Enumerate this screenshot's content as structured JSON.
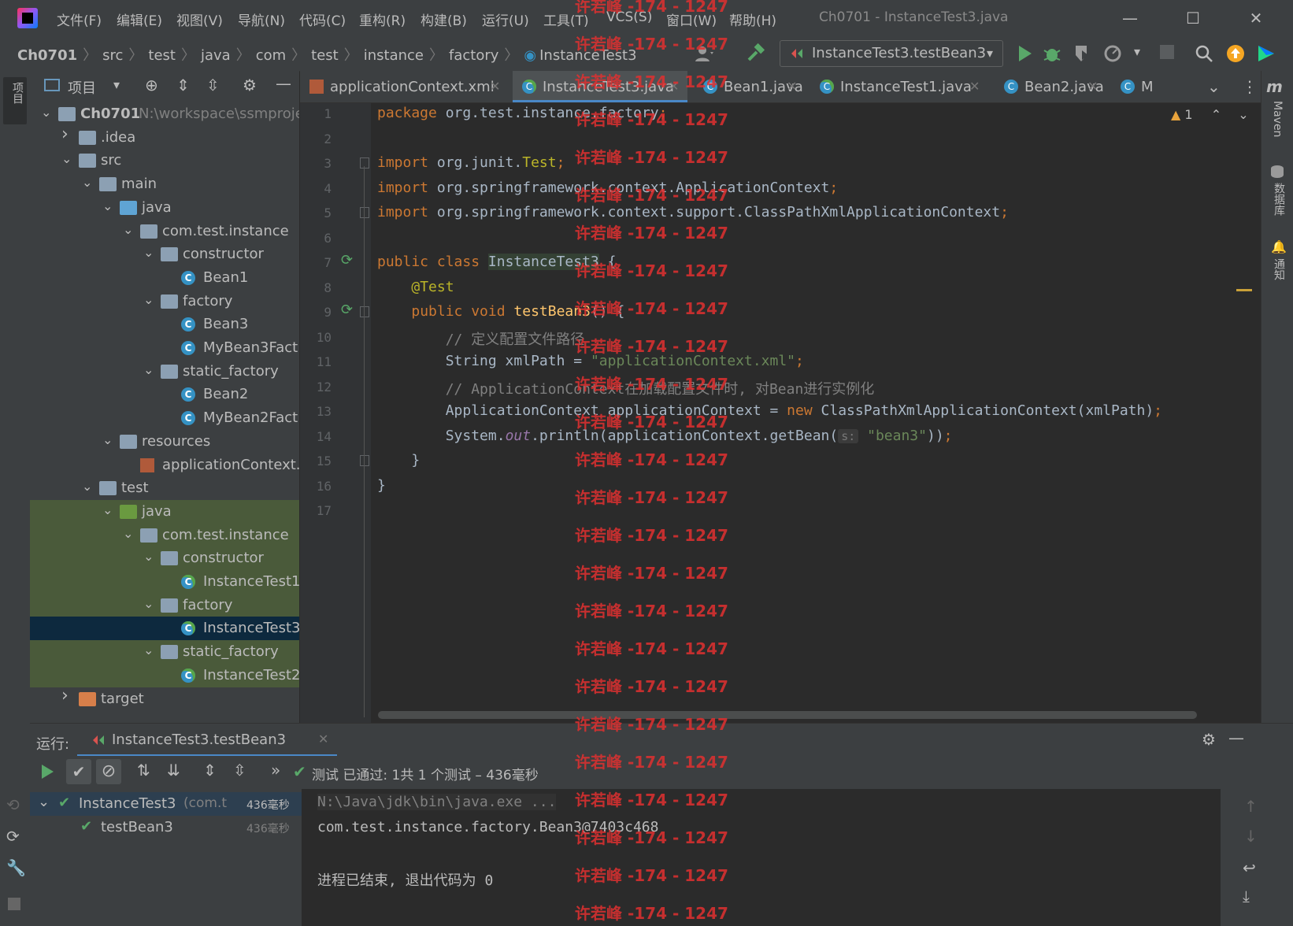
{
  "menu": [
    "文件(F)",
    "编辑(E)",
    "视图(V)",
    "导航(N)",
    "代码(C)",
    "重构(R)",
    "构建(B)",
    "运行(U)",
    "工具(T)",
    "VCS(S)",
    "窗口(W)",
    "帮助(H)"
  ],
  "window_title": "Ch0701 - InstanceTest3.java",
  "breadcrumb": [
    "Ch0701",
    "src",
    "test",
    "java",
    "com",
    "test",
    "instance",
    "factory",
    "InstanceTest3"
  ],
  "run_config": "InstanceTest3.testBean3",
  "project_panel": {
    "title": "项目",
    "tree": [
      {
        "label": "Ch0701",
        "path": "N:\\workspace\\ssmproje",
        "depth": 0,
        "expanded": true,
        "icon": "module-folder"
      },
      {
        "label": ".idea",
        "depth": 1,
        "expanded": false,
        "icon": "folder"
      },
      {
        "label": "src",
        "depth": 1,
        "expanded": true,
        "icon": "folder"
      },
      {
        "label": "main",
        "depth": 2,
        "expanded": true,
        "icon": "folder"
      },
      {
        "label": "java",
        "depth": 3,
        "expanded": true,
        "icon": "source-folder"
      },
      {
        "label": "com.test.instance",
        "depth": 4,
        "expanded": true,
        "icon": "package"
      },
      {
        "label": "constructor",
        "depth": 5,
        "expanded": true,
        "icon": "package"
      },
      {
        "label": "Bean1",
        "depth": 6,
        "icon": "class"
      },
      {
        "label": "factory",
        "depth": 5,
        "expanded": true,
        "icon": "package"
      },
      {
        "label": "Bean3",
        "depth": 6,
        "icon": "class"
      },
      {
        "label": "MyBean3Fact",
        "depth": 6,
        "icon": "class"
      },
      {
        "label": "static_factory",
        "depth": 5,
        "expanded": true,
        "icon": "package"
      },
      {
        "label": "Bean2",
        "depth": 6,
        "icon": "class"
      },
      {
        "label": "MyBean2Fact",
        "depth": 6,
        "icon": "class"
      },
      {
        "label": "resources",
        "depth": 3,
        "expanded": true,
        "icon": "resources-folder"
      },
      {
        "label": "applicationContext.",
        "depth": 4,
        "icon": "xml-file"
      },
      {
        "label": "test",
        "depth": 2,
        "expanded": true,
        "icon": "folder"
      },
      {
        "label": "java",
        "depth": 3,
        "expanded": true,
        "icon": "test-folder"
      },
      {
        "label": "com.test.instance",
        "depth": 4,
        "expanded": true,
        "icon": "package"
      },
      {
        "label": "constructor",
        "depth": 5,
        "expanded": true,
        "icon": "package"
      },
      {
        "label": "InstanceTest1",
        "depth": 6,
        "icon": "test-class"
      },
      {
        "label": "factory",
        "depth": 5,
        "expanded": true,
        "icon": "package"
      },
      {
        "label": "InstanceTest3",
        "depth": 6,
        "icon": "test-class",
        "selected": true
      },
      {
        "label": "static_factory",
        "depth": 5,
        "expanded": true,
        "icon": "package"
      },
      {
        "label": "InstanceTest2",
        "depth": 6,
        "icon": "test-class"
      },
      {
        "label": "target",
        "depth": 1,
        "expanded": false,
        "icon": "excluded-folder"
      }
    ]
  },
  "tabs": [
    {
      "label": "applicationContext.xml",
      "icon": "xml-icon"
    },
    {
      "label": "InstanceTest3.java",
      "icon": "test-class-icon",
      "active": true
    },
    {
      "label": "Bean1.java",
      "icon": "class-icon"
    },
    {
      "label": "InstanceTest1.java",
      "icon": "test-class-icon"
    },
    {
      "label": "Bean2.java",
      "icon": "class-icon"
    },
    {
      "label": "M",
      "icon": "class-icon"
    }
  ],
  "editor": {
    "warning_count": "1",
    "lines": [
      {
        "n": "1",
        "tokens": [
          [
            "kw",
            "package "
          ],
          [
            "",
            "org.test.instance.factory"
          ],
          [
            "kw",
            ";"
          ]
        ]
      },
      {
        "n": "2",
        "tokens": []
      },
      {
        "n": "3",
        "tokens": [
          [
            "kw",
            "import "
          ],
          [
            "",
            "org.junit."
          ],
          [
            "ann",
            "Test"
          ],
          [
            "kw",
            ";"
          ]
        ]
      },
      {
        "n": "4",
        "tokens": [
          [
            "kw",
            "import "
          ],
          [
            "",
            "org.springframework.context.ApplicationContext"
          ],
          [
            "kw",
            ";"
          ]
        ]
      },
      {
        "n": "5",
        "tokens": [
          [
            "kw",
            "import "
          ],
          [
            "",
            "org.springframework.context.support.ClassPathXmlApplicationContext"
          ],
          [
            "kw",
            ";"
          ]
        ]
      },
      {
        "n": "6",
        "tokens": []
      },
      {
        "n": "7",
        "tokens": [
          [
            "kw",
            "public class "
          ],
          [
            "cls-hl",
            "InstanceTest3"
          ],
          [
            "",
            " {"
          ]
        ]
      },
      {
        "n": "8",
        "tokens": [
          [
            "",
            "    "
          ],
          [
            "ann",
            "@Test"
          ]
        ]
      },
      {
        "n": "9",
        "tokens": [
          [
            "",
            "    "
          ],
          [
            "kw",
            "public void "
          ],
          [
            "fn",
            "testBean3"
          ],
          [
            "",
            "() {"
          ]
        ]
      },
      {
        "n": "10",
        "tokens": [
          [
            "",
            "        "
          ],
          [
            "cmt",
            "// 定义配置文件路径"
          ]
        ]
      },
      {
        "n": "11",
        "tokens": [
          [
            "",
            "        String xmlPath = "
          ],
          [
            "str",
            "\"applicationContext.xml\""
          ],
          [
            "kw",
            ";"
          ]
        ]
      },
      {
        "n": "12",
        "tokens": [
          [
            "",
            "        "
          ],
          [
            "cmt",
            "// ApplicationContext在加载配置文件时, 对Bean进行实例化"
          ]
        ]
      },
      {
        "n": "13",
        "tokens": [
          [
            "",
            "        ApplicationContext applicationContext = "
          ],
          [
            "kw",
            "new "
          ],
          [
            "",
            "ClassPathXmlApplicationContext(xmlPath)"
          ],
          [
            "kw",
            ";"
          ]
        ]
      },
      {
        "n": "14",
        "tokens": [
          [
            "",
            "        System."
          ],
          [
            "fld",
            "out"
          ],
          [
            "",
            ".println(applicationContext.getBean("
          ],
          [
            "hint",
            "s:"
          ],
          [
            "",
            " "
          ],
          [
            "str",
            "\"bean3\""
          ],
          [
            "",
            "))"
          ],
          [
            "kw",
            ";"
          ]
        ]
      },
      {
        "n": "15",
        "tokens": [
          [
            "",
            "    }"
          ]
        ]
      },
      {
        "n": "16",
        "tokens": [
          [
            "",
            "}"
          ]
        ]
      },
      {
        "n": "17",
        "tokens": []
      }
    ]
  },
  "right_stripe": [
    "Maven",
    "数据库",
    "通知"
  ],
  "run_panel": {
    "label": "运行:",
    "tab": "InstanceTest3.testBean3",
    "status": "测试 已通过: 1共 1 个测试 – 436毫秒",
    "tree": [
      {
        "label": "InstanceTest3",
        "sub": "(com.t",
        "time": "436毫秒",
        "depth": 0
      },
      {
        "label": "testBean3",
        "sub": "",
        "time": "436毫秒",
        "depth": 1
      }
    ],
    "console": [
      "N:\\Java\\jdk\\bin\\java.exe ...",
      "com.test.instance.factory.Bean3@7403c468",
      "",
      "进程已结束, 退出代码为 0"
    ]
  },
  "watermark": "许若峰 -174 - 1247",
  "colors": {
    "accent": "#4a88c7",
    "run_green": "#59a869",
    "watermark": "#e03030"
  }
}
